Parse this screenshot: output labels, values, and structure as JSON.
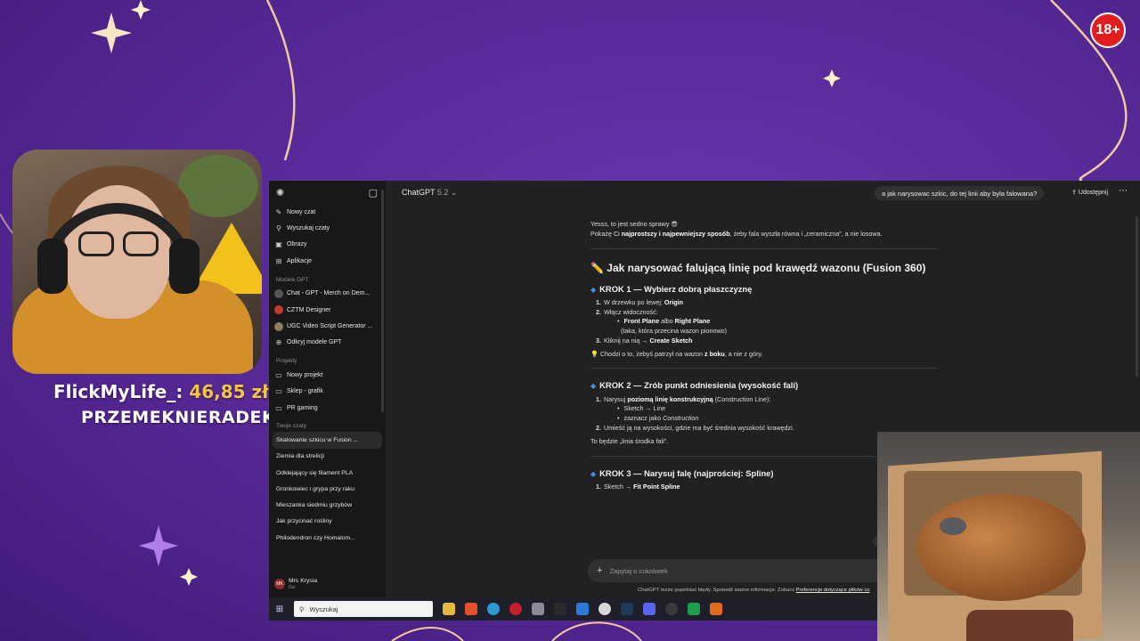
{
  "stream": {
    "donation_name": "FlickMyLife_:",
    "donation_amount": "46,85 zł",
    "donor": "PRZEMEKNIERADEK",
    "heart": "♥",
    "age_badge": "18+"
  },
  "sidebar": {
    "top_items": [
      {
        "icon": "new-chat-icon",
        "label": "Nowy czat"
      },
      {
        "icon": "search-icon",
        "label": "Wyszukaj czaty"
      },
      {
        "icon": "images-icon",
        "label": "Obrazy"
      },
      {
        "icon": "apps-icon",
        "label": "Aplikacje"
      }
    ],
    "gpt_section": "Modele GPT",
    "gpts": [
      {
        "label": "Chat - GPT - Merch on Dem..."
      },
      {
        "label": "CZTM Designer"
      },
      {
        "label": "UGC Video Script Generator ..."
      },
      {
        "label": "Odkryj modele GPT"
      }
    ],
    "projects_section": "Projekty",
    "projects": [
      {
        "label": "Nowy projekt"
      },
      {
        "label": "Sklep - grafik"
      },
      {
        "label": "PR gaming"
      }
    ],
    "chats_section": "Twoje czaty",
    "chats": [
      {
        "label": "Skalowanie szkicu w Fusion ...",
        "active": true
      },
      {
        "label": "Ziemia dla strelicji"
      },
      {
        "label": "Odklejający się filament PLA"
      },
      {
        "label": "Gronkowiec i grypa przy raku"
      },
      {
        "label": "Mieszanka siedmiu grzybów"
      },
      {
        "label": "Jak przycinać rośliny"
      },
      {
        "label": "Philodendron czy Homalom..."
      }
    ],
    "user": {
      "initials": "MK",
      "name": "Mrs Krysia",
      "plan": "Go"
    }
  },
  "header": {
    "model": "ChatGPT",
    "version": "5.2",
    "user_message": "a jak narysowac szkic, do tej linii aby byla falowana?",
    "share": "Udostępnij"
  },
  "answer": {
    "intro_line1": "Yesss, to jest sedno sprawy 😎",
    "intro_line2_pre": "Pokażę Ci ",
    "intro_line2_bold": "najprostszy i najpewniejszy sposób",
    "intro_line2_post": ", żeby fala wyszła równa i „ceramiczna”, a nie losowa.",
    "title": "Jak narysować falującą linię pod krawędź wazonu (Fusion 360)",
    "step1": {
      "title": "KROK 1 — Wybierz dobrą płaszczyznę",
      "i1_pre": "W drzewku po lewej: ",
      "i1_bold": "Origin",
      "i2": "Włącz widoczność:",
      "i2a_bold1": "Front Plane",
      "i2a_mid": " albo ",
      "i2a_bold2": "Right Plane",
      "i2b": "(taka, która przecina wazon pionowo)",
      "i3_pre": "Kliknij na nią → ",
      "i3_bold": "Create Sketch",
      "tip_pre": "💡 Chodzi o to, żebyś patrzył na wazon ",
      "tip_bold": "z boku",
      "tip_post": ", a nie z góry."
    },
    "step2": {
      "title": "KROK 2 — Zrób punkt odniesienia (wysokość fali)",
      "i1_pre": "Narysuj ",
      "i1_bold": "poziomą linię konstrukcyjną",
      "i1_post": " (Construction Line):",
      "i1a": "Sketch → Line",
      "i1b_pre": "zaznacz jako ",
      "i1b_italic": "Construction",
      "i2": "Umieść ją na wysokości, gdzie ma być średnia wysokość krawędzi.",
      "note": "To będzie „linia środka fali”."
    },
    "step3": {
      "title": "KROK 3 — Narysuj falę (najprościej: Spline)",
      "i1_pre": "Sketch → ",
      "i1_bold": "Fit Point Spline"
    }
  },
  "composer": {
    "placeholder": "Zapytaj o cokolwiek",
    "disclaimer": "ChatGPT może popełniać błędy. Sprawdź ważne informacje. Zobacz ",
    "disclaimer_link": "Preferencje dotyczące plików co"
  },
  "taskbar": {
    "search_placeholder": "Wyszukaj"
  },
  "colors": {
    "accent_diamond": "#4a90e2",
    "background_purple": "#5a2a9a",
    "chat_bg": "#212121",
    "sidebar_bg": "#181818"
  }
}
